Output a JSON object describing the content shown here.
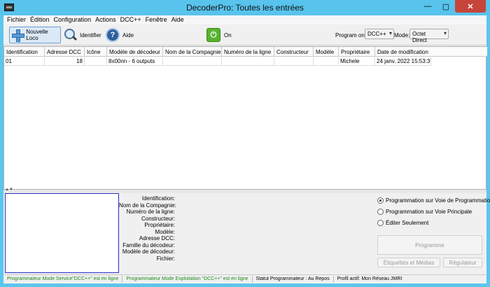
{
  "window": {
    "title": "DecoderPro: Toutes les entrées",
    "min": "—",
    "max": "▢",
    "close": "✕"
  },
  "menu": [
    "Fichier",
    "Édition",
    "Configuration",
    "Actions",
    "DCC++",
    "Fenêtre",
    "Aide"
  ],
  "toolbar": {
    "new_loco": "Nouvelle Loco",
    "identify": "Identifier",
    "help": "Aide",
    "help_glyph": "?",
    "power_glyph": "⏻",
    "power_label": "On",
    "program_on_label": "Program on:",
    "program_on_value": "DCC++",
    "mode_label": "Mode:",
    "mode_value": "Octet Direct",
    "arrow": "▾"
  },
  "table": {
    "columns": [
      "Identification",
      "Adresse DCC",
      "Icône",
      "Modèle de décodeur",
      "Nom de la Compagnie",
      "Numéro de la ligne",
      "Constructeur",
      "Modèle",
      "Propriétaire",
      "Date de modification"
    ],
    "rows": [
      [
        "01",
        "18",
        "",
        "8x00nn - 6 outputs",
        "",
        "",
        "",
        "",
        "Michele",
        "24 janv. 2022 15:53:39"
      ]
    ]
  },
  "splitter": {
    "arrows": "▲▼"
  },
  "details": {
    "labels": [
      "Identification:",
      "Nom de la Compagnie:",
      "Numéro de la ligne:",
      "Constructeur:",
      "Propriétaire:",
      "Modèle:",
      "Adresse DCC:",
      "Famille du décodeur:",
      "Modèle de décodeur:",
      "Fichier:"
    ]
  },
  "programming": {
    "options": [
      "Programmation sur Voie de Programmation",
      "Programmation sur Voie Principale",
      "Éditer Seulement"
    ],
    "selected_index": 0,
    "program_button": "Programme",
    "labels_button": "Étiquettes et Médias",
    "throttle_button": "Régulateur"
  },
  "status": {
    "service": "Programmateur Mode Service\"DCC++\" est en ligne",
    "ops": "Programmateur Mode Exploitation \"DCC++\" est en ligne",
    "programmer_state": "Statut Programmateur :  Au Repos",
    "profile": "Profil actif: Mon Réseau JMRI"
  }
}
